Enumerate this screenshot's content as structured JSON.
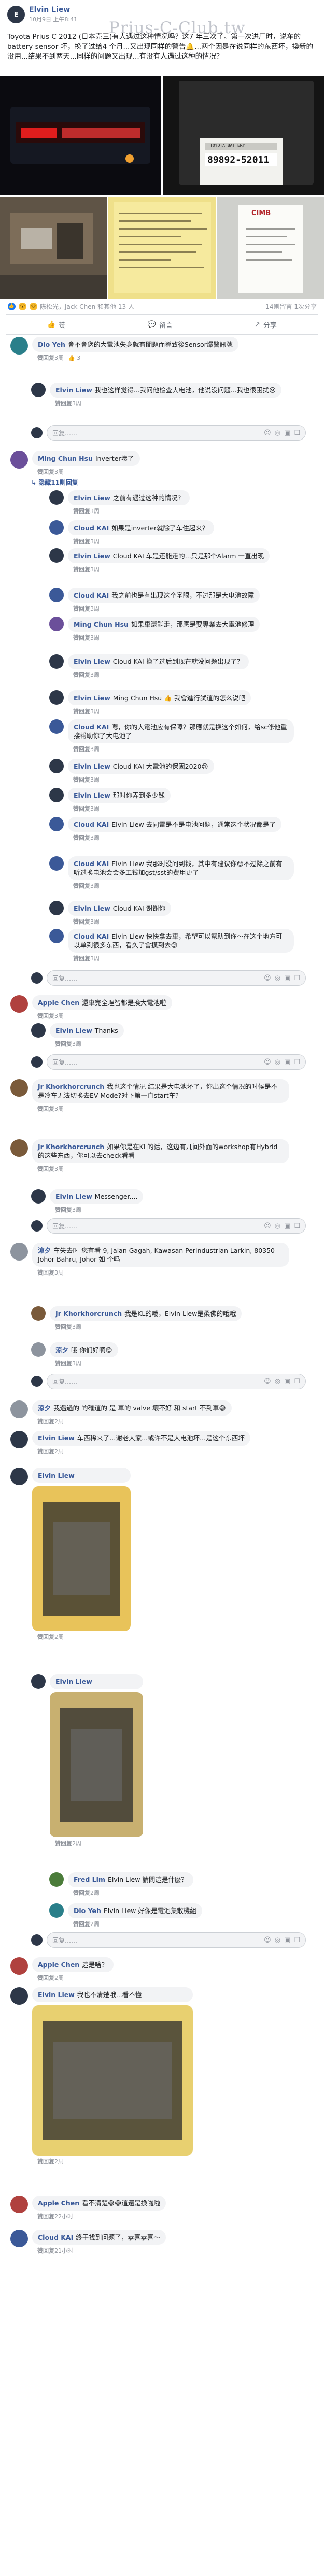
{
  "post": {
    "author": "Elvin Liew",
    "time": "10月9日 上午8:41",
    "watermark": "Prius-C-Club.tw",
    "text": "Toyota Prius C 2012 (日本売三)有人遇过这种情况吗？这7 年三次了。第一次进厂时，说车的battery sensor 坏，换了过给4 个月...又出现同样的警告🔔...两个因是在说同样的东西坏，換新的没用...结果不到两天...同样的问题又出现...有没有人遇过这种的情况？",
    "photos": {
      "label_code": "89892-52011",
      "label_top": "TOYOTA BATTERY",
      "receipt_logo": "CIMB"
    },
    "reactions_text": "陈松光，Jack Chen 和其他 13 人",
    "comments_count": "14则留言 1次分享",
    "actions": {
      "like": "赞",
      "comment": "留言",
      "share": "分享"
    }
  },
  "comments": [
    {
      "name": "Dio Yeh",
      "text": "會不會您的大電池失身就有間題而導致後Sensor爆警訊號",
      "likes": "3",
      "time": "3周"
    },
    {
      "name": "Elvin Liew",
      "text": "我也这样觉得...我问他检查大电池，他说没问题...我也很困扰😢",
      "time": "3周"
    },
    {
      "placeholder": "回复……"
    },
    {
      "name": "Ming Chun Hsu",
      "text": "Inverter壞了",
      "time": "3周"
    },
    {
      "replies": "隐藏11则回复"
    },
    {
      "name": "Elvin Liew",
      "text": "之前有遇过这种的情况？",
      "time": "3周"
    },
    {
      "name": "Cloud KAI",
      "text": "如果是inverter就除了车住起来？",
      "time": "3周"
    },
    {
      "name": "Elvin Liew",
      "text": "Cloud KAI 车是还能走的...只是那个Alarm 一直出现",
      "time": "3周"
    },
    {
      "name": "Cloud KAI",
      "text": "我之前也是有出现这个字眼，不过那是大电池故障",
      "time": "3周"
    },
    {
      "name": "Ming Chun Hsu",
      "text": "如果車還能走，那應是要專業去大電池修理",
      "time": "3周"
    },
    {
      "name": "Elvin Liew",
      "text": "Cloud KAI 换了过后到现在就没问题出现了？",
      "time": "3周"
    },
    {
      "name": "Elvin Liew",
      "text": "Ming Chun Hsu 👍 我會進行試這的怎么说吧",
      "time": "3周"
    },
    {
      "name": "Cloud KAI",
      "text": "嗯，你的大電池应有保障？那應就是换这个如何，给sc修他重接帮助你了大电池了",
      "time": "3周"
    },
    {
      "name": "Elvin Liew",
      "text": "Cloud KAI 大電池的保固2020😢",
      "time": "3周"
    },
    {
      "name": "Elvin Liew",
      "text": "那时你弄到多少钱",
      "time": "3周"
    },
    {
      "name": "Cloud KAI",
      "text": "Elvin Liew 去同電是不是电池问题，通常这个状况都是了",
      "time": "3周"
    },
    {
      "name": "Cloud KAI",
      "text": "Elvin Liew 我那时没问到钱，其中有建议你😊不过除之前有听过换电池会会多工钱加gst/sst的费用更了",
      "time": "3周"
    },
    {
      "name": "Elvin Liew",
      "text": "Cloud KAI 谢谢你",
      "time": "3周"
    },
    {
      "name": "Cloud KAI",
      "text": "Elvin Liew 快快拿去車，希望可以幫助到你～在这个地方可以单到很多东西，看久了會摸到去😊",
      "time": "3周"
    },
    {
      "placeholder": "回复……"
    },
    {
      "name": "Apple Chen",
      "text": "還車完全理智都是換大電池啦",
      "time": "3周"
    },
    {
      "name": "Elvin Liew",
      "text": "Thanks",
      "time": "3周"
    },
    {
      "placeholder": "回复……"
    },
    {
      "name": "Jr Khorkhorcrunch",
      "text": "我也这个情况 结果是大电池坏了，你出这个情况的时候是不是冷车无法切换去EV Mode?对下第一直start车？",
      "time": "3周"
    },
    {
      "name": "Jr Khorkhorcrunch",
      "text": "如果你是在KL的话，这边有几间外面的workshop有Hybrid的这些东西，你可以去check看看",
      "time": "3周"
    },
    {
      "name": "Elvin Liew",
      "text": "Messenger....",
      "time": "3周"
    },
    {
      "placeholder": "回复……"
    },
    {
      "name": "涼夕",
      "text": "车失去时 您有看 9, Jalan Gagah, Kawasan Perindustrian Larkin, 80350 Johor Bahru, Johor 如 个吗",
      "time": "3周"
    },
    {
      "name": "Jr Khorkhorcrunch",
      "text": "我是KL的哦，Elvin Liew是柔佛的哦哦",
      "time": "3周"
    },
    {
      "name": "涼夕",
      "text": "哦 你们好啊😊",
      "time": "3周"
    },
    {
      "placeholder": "回复……"
    },
    {
      "name": "涼夕",
      "text": "我遇過的 的確這的 是 車的 valve 壞不好 和 start 不到車😅",
      "time": "2周"
    },
    {
      "name": "Elvin Liew",
      "text": "车西稀来了...谢老大家...或许不是大电池坏...是这个东西坏",
      "time": "2周"
    },
    {
      "name": "Elvin Liew",
      "time": "2周"
    },
    {
      "name": "Elvin Liew",
      "time": "2周"
    },
    {
      "name": "Fred Lim",
      "text": "Elvin Liew 請問這是什麼？",
      "time": "2周"
    },
    {
      "name": "Dio Yeh",
      "text": "Elvin Liew 好像是電池集散機組",
      "time": "2周"
    },
    {
      "placeholder": "回复……"
    },
    {
      "name": "Apple Chen",
      "text": "這是啥？",
      "time": "2周"
    },
    {
      "name": "Elvin Liew",
      "text": "我也不清楚哦...看不懂",
      "time": "2周"
    },
    {
      "name": "Apple Chen",
      "text": "看不清楚😅😅這還是換啦啦",
      "time": "22小时"
    },
    {
      "name": "Cloud KAI",
      "text": "终于找到问题了，恭喜恭喜～",
      "time": "21小时"
    }
  ],
  "ui": {
    "like": "赞",
    "reply": "回复",
    "seen_like": "赞"
  }
}
